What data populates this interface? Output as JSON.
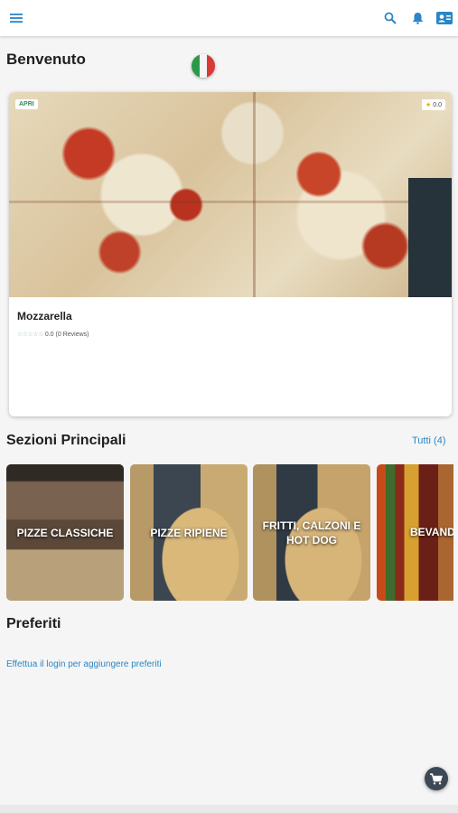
{
  "header": {
    "icons": [
      "menu-icon",
      "search-icon",
      "bell-icon",
      "contact-card-icon"
    ],
    "accent": "#2a86c6"
  },
  "welcome": {
    "title": "Benvenuto",
    "flag_icon": "italy-flag-icon"
  },
  "featured": {
    "status_badge": "APRI",
    "rating_badge": "0.0",
    "name": "Mozzarella",
    "rating_text": "0.0 (0 Reviews)",
    "stars": "☆☆☆☆☆"
  },
  "sections": {
    "title": "Sezioni Principali",
    "all_link": "Tutti (4)",
    "items": [
      {
        "label": "PIZZE CLASSICHE"
      },
      {
        "label": "PIZZE RIPIENE"
      },
      {
        "label": "FRITTI, CALZONI E HOT DOG"
      },
      {
        "label": "BEVAND"
      }
    ]
  },
  "favorites": {
    "title": "Preferiti",
    "login_text": "Effettua il login per aggiungere preferiti"
  },
  "cart": {
    "icon": "cart-icon"
  }
}
